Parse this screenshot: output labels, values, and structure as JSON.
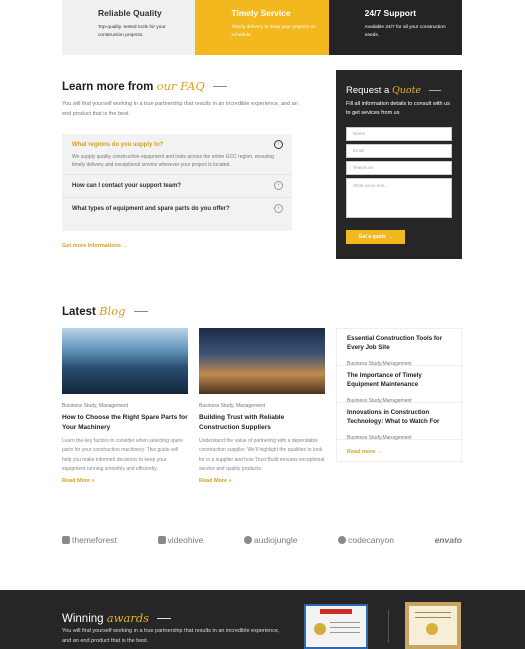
{
  "features": [
    {
      "title": "Reliable Quality",
      "text": "Top-quality, tested tools for your construction projects."
    },
    {
      "title": "Timely Service",
      "text": "Timely delivery to keep your projects on schedule."
    },
    {
      "title": "24/7 Support",
      "text": "Available 24/7 for all your construction needs."
    }
  ],
  "faq": {
    "title": "Learn more from",
    "title_accent": "our FAQ",
    "intro": "You will find yourself working in a true partnership that results in an incredible experience, and an end product that is the best.",
    "items": [
      {
        "question": "What regions do you supply to?",
        "answer": "We supply quality construction equipment and tools across the entire GCC region, ensuring timely delivery and exceptional service wherever your project is located.",
        "open_icon": "↑",
        "closed_icon": ""
      },
      {
        "question": "How can I contact your support team?",
        "answer": ""
      },
      {
        "question": "What types of equipment and spare parts do you offer?",
        "answer": ""
      }
    ],
    "link": "Get more Informations →"
  },
  "quote": {
    "title": "Request a",
    "title_accent": "Quote",
    "text": "Fill all information details to consult with us to get sevices from us",
    "name_placeholder": "Name",
    "email_placeholder": "Email",
    "phone_placeholder": "Telephone",
    "message_placeholder": "Write some text...",
    "button": "Get a quote →"
  },
  "blog": {
    "title": "Latest",
    "title_accent": "Blog",
    "posts": [
      {
        "category": "Business Study, Management",
        "title": "How to Choose the Right Spare Parts for Your Machinery",
        "excerpt": "Learn the key factors to consider when selecting spare parts for your construction machinery. This guide will help you make informed decisions to keep your equipment running smoothly and efficiently.",
        "read_more": "Read More »"
      },
      {
        "category": "Business Study, Management",
        "title": "Building Trust with Reliable Construction Suppliers",
        "excerpt": "Understand the value of partnering with a dependable construction supplier. We'll highlight the qualities to look for in a supplier and how Trust Build ensures exceptional service and quality products.",
        "read_more": "Read More »"
      }
    ],
    "side": [
      {
        "title": "Essential Construction Tools for Every Job Site",
        "category": "Business Study,Management"
      },
      {
        "title": "The Importance of Timely Equipment Maintenance",
        "category": "Business Study,Management"
      },
      {
        "title": "Innovations in Construction Technology: What to Watch For",
        "category": "Business Study,Management"
      }
    ],
    "side_more": "Read more →"
  },
  "logos": [
    "themeforest",
    "videohive",
    "audiojungle",
    "codecanyon",
    "envato"
  ],
  "awards": {
    "title": "Winning",
    "title_accent": "awards",
    "text": "You will find yourself working in a true partnership that results in an incredible experience, and an end product that is the best."
  }
}
